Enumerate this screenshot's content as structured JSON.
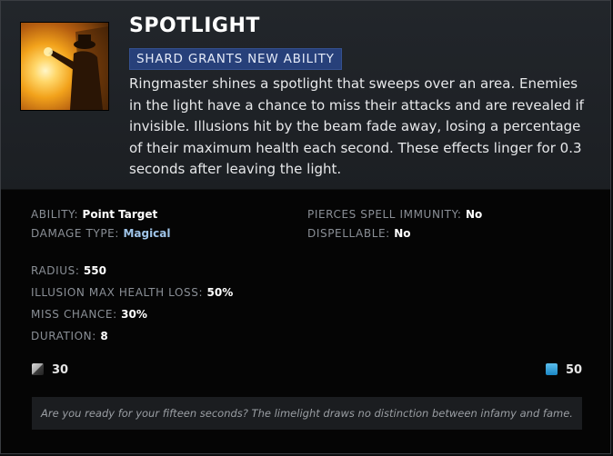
{
  "ability": {
    "name": "SPOTLIGHT",
    "badge": "SHARD GRANTS NEW ABILITY",
    "description": "Ringmaster shines a spotlight that sweeps over an area. Enemies in the light have a chance to miss their attacks and are revealed if invisible. Illusions hit by the beam fade away, losing a percentage of their maximum health each second. These effects linger for 0.3 seconds after leaving the light.",
    "icon": "ringmaster-spotlight-icon"
  },
  "properties_left": [
    {
      "label": "ABILITY:",
      "value": "Point Target"
    },
    {
      "label": "DAMAGE TYPE:",
      "value": "Magical"
    }
  ],
  "properties_right": [
    {
      "label": "PIERCES SPELL IMMUNITY:",
      "value": "No"
    },
    {
      "label": "DISPELLABLE:",
      "value": "No"
    }
  ],
  "attributes": [
    {
      "label": "RADIUS:",
      "value": "550"
    },
    {
      "label": "ILLUSION MAX HEALTH LOSS:",
      "value": "50%"
    },
    {
      "label": "MISS CHANCE:",
      "value": "30%"
    },
    {
      "label": "DURATION:",
      "value": "8"
    }
  ],
  "cooldown": {
    "icon": "cooldown-icon",
    "value": "30"
  },
  "mana": {
    "icon": "mana-icon",
    "value": "50"
  },
  "lore": "Are you ready for your fifteen seconds? The limelight draws no distinction between infamy and fame.",
  "colors": {
    "badge_bg": "#27407a",
    "magical": "#9fc4e8",
    "mana": "#1a86c4"
  }
}
